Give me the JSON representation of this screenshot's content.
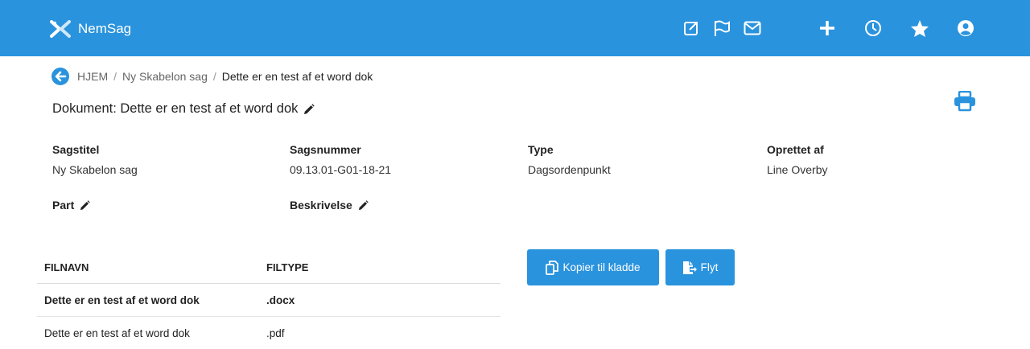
{
  "header": {
    "brand": "NemSag",
    "icons": [
      "external-link-icon",
      "flag-icon",
      "mail-icon",
      "plus-icon",
      "clock-icon",
      "star-icon",
      "user-icon"
    ]
  },
  "breadcrumb": {
    "items": [
      "HJEM",
      "Ny Skabelon sag",
      "Dette er en test af et word dok"
    ],
    "separator": "/"
  },
  "document": {
    "title": "Dokument: Dette er en test af et word dok"
  },
  "meta": {
    "sagstitel": {
      "label": "Sagstitel",
      "value": "Ny Skabelon sag"
    },
    "sagsnummer": {
      "label": "Sagsnummer",
      "value": "09.13.01-G01-18-21"
    },
    "type": {
      "label": "Type",
      "value": "Dagsordenpunkt"
    },
    "oprettet": {
      "label": "Oprettet af",
      "value": "Line Overby"
    },
    "part": {
      "label": "Part"
    },
    "beskrivelse": {
      "label": "Beskrivelse"
    }
  },
  "files": {
    "columns": [
      "FILNAVN",
      "FILTYPE"
    ],
    "rows": [
      {
        "name": "Dette er en test af et word dok",
        "type": ".docx",
        "bold": true
      },
      {
        "name": "Dette er en test af et word dok",
        "type": ".pdf",
        "bold": false
      }
    ]
  },
  "actions": {
    "copy_label": "Kopier til kladde",
    "move_label": "Flyt"
  },
  "colors": {
    "primary": "#2a93dd",
    "text": "#222222"
  }
}
